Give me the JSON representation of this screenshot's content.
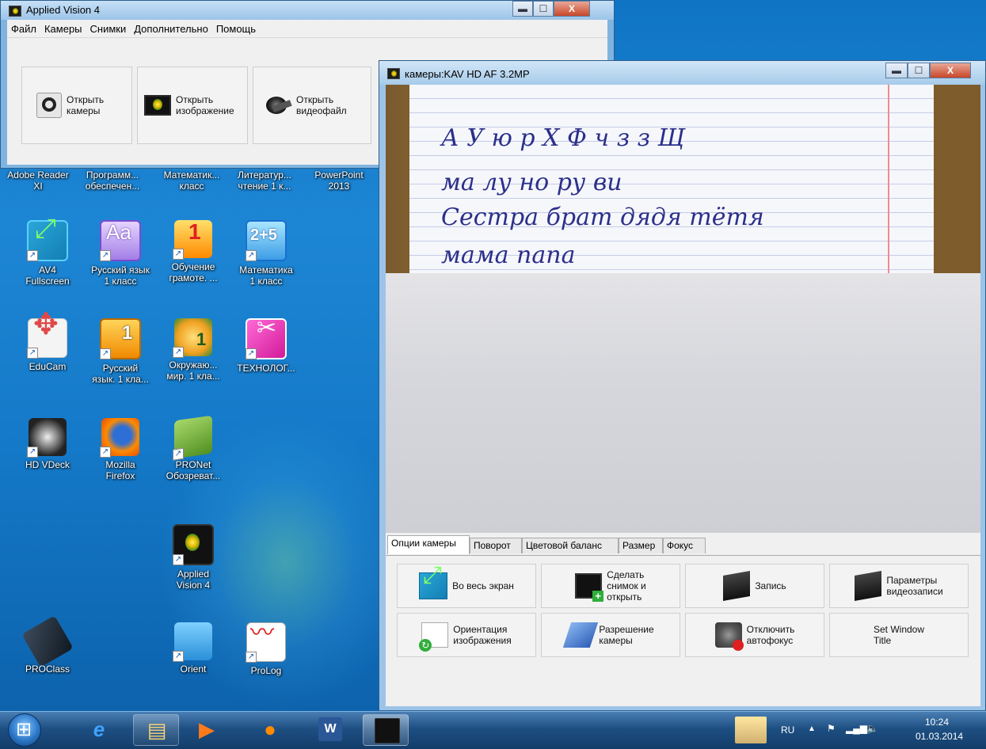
{
  "main_window": {
    "title": "Applied Vision 4",
    "menu": [
      "Файл",
      "Камеры",
      "Снимки",
      "Дополнительно",
      "Помощь"
    ],
    "toolbar": [
      {
        "line1": "Открыть",
        "line2": "камеры",
        "icon": "webcam-icon"
      },
      {
        "line1": "Открыть",
        "line2": "изображение",
        "icon": "image-icon"
      },
      {
        "line1": "Открыть",
        "line2": "видеофайл",
        "icon": "film-reel-icon"
      }
    ],
    "caption": {
      "minimize": "▬",
      "maximize": "☐",
      "close": "X"
    }
  },
  "desktop": {
    "top_row": [
      {
        "line1": "Adobe Reader",
        "line2": "XI"
      },
      {
        "line1": "Программ...",
        "line2": "обеспечен..."
      },
      {
        "line1": "Математик...",
        "line2": "класс"
      },
      {
        "line1": "Литератур...",
        "line2": "чтение 1 к..."
      },
      {
        "line1": "PowerPoint",
        "line2": "2013"
      }
    ],
    "icons": [
      {
        "line1": "AV4",
        "line2": "Fullscreen"
      },
      {
        "line1": "Русский язык",
        "line2": "1 класс"
      },
      {
        "line1": "Обучение",
        "line2": "грамоте. ..."
      },
      {
        "line1": "Математика",
        "line2": "1 класс"
      },
      {
        "line1": "EduCam",
        "line2": ""
      },
      {
        "line1": "Русский",
        "line2": "язык. 1 кла..."
      },
      {
        "line1": "Окружаю...",
        "line2": "мир. 1 кла..."
      },
      {
        "line1": "ТЕХНОЛОГ...",
        "line2": ""
      },
      {
        "line1": "HD VDeck",
        "line2": ""
      },
      {
        "line1": "Mozilla",
        "line2": "Firefox"
      },
      {
        "line1": "PRONet",
        "line2": "Обозреват..."
      },
      {
        "line1": "Applied",
        "line2": "Vision 4"
      },
      {
        "line1": "PROClass",
        "line2": ""
      },
      {
        "line1": "Orient",
        "line2": ""
      },
      {
        "line1": "ProLog",
        "line2": ""
      }
    ]
  },
  "camera_window": {
    "title": "камеры:KAV HD AF 3.2MP",
    "handwriting": [
      "А У ю р Х Ф ч з з Щ",
      "ма лу но ру ви",
      "Сестра брат дядя тётя",
      "мама папа"
    ],
    "tabs": [
      "Опции камеры",
      "Поворот",
      "Цветовой баланс",
      "Размер",
      "Фокус"
    ],
    "buttons": [
      {
        "lines": [
          "Во весь экран"
        ]
      },
      {
        "lines": [
          "Сделать",
          "снимок и",
          "открыть"
        ]
      },
      {
        "lines": [
          "Запись"
        ]
      },
      {
        "lines": [
          "Параметры",
          "видеозаписи"
        ]
      },
      {
        "lines": [
          "Ориентация",
          "изображения"
        ]
      },
      {
        "lines": [
          "Разрешение",
          "камеры"
        ]
      },
      {
        "lines": [
          "Отключить",
          "автофокус"
        ]
      },
      {
        "lines": [
          "Set Window",
          "Title"
        ]
      }
    ]
  },
  "taskbar": {
    "lang": "RU",
    "time": "10:24",
    "date": "01.03.2014",
    "tray_up": "▲"
  }
}
